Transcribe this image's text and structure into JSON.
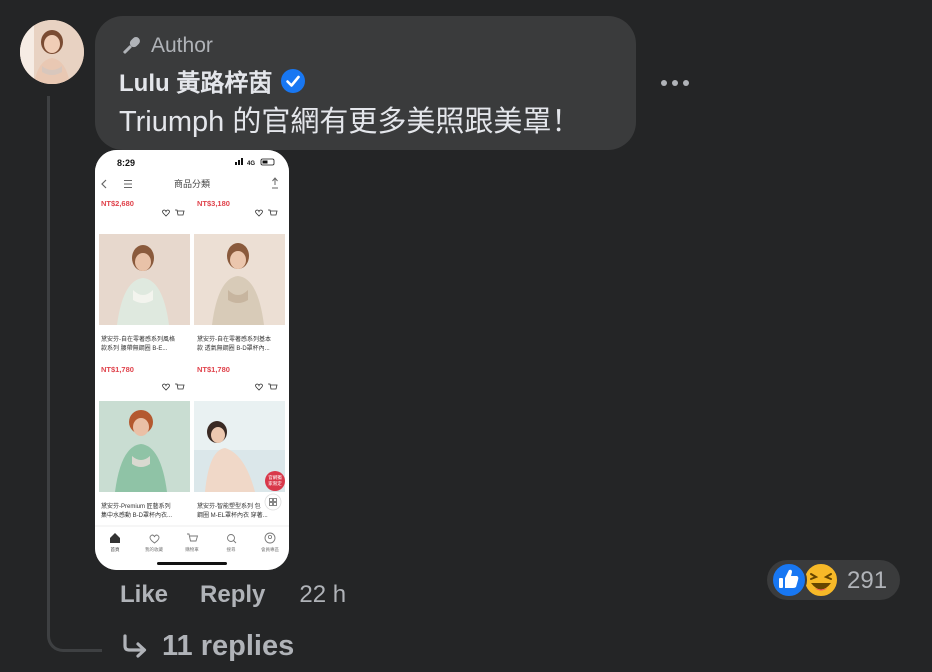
{
  "comment": {
    "badge_label": "Author",
    "author_name": "Lulu 黃路梓茵",
    "verified": true,
    "text": "Triumph 的官網有更多美照跟美罩！"
  },
  "attachment": {
    "status_time": "8:29",
    "signal_label": "4G",
    "page_title": "商品分類",
    "products": [
      {
        "price": "NT$2,680",
        "title_line1": "黛安芬-自在零著感系列風格",
        "title_line2": "款系列 腰帶無鋼圈 B-E..."
      },
      {
        "price": "NT$3,180",
        "title_line1": "黛安芬-自在零著感系列基本",
        "title_line2": "款 透氣無鋼圈 B-D罩杯內..."
      },
      {
        "price": "NT$1,780",
        "title_line1": "黛安芬-Premium 匠藝系列",
        "title_line2": "集中水感動 B-D罩杯內衣..."
      },
      {
        "price": "NT$1,780",
        "title_line1": "黛安芬-智能塑型系列 包",
        "title_line2": "鋼圈 M-EL罩杯內衣 穿著..."
      }
    ],
    "promo_tag_line1": "官網獨",
    "promo_tag_line2": "家限定",
    "nav": [
      "首頁",
      "我的收藏",
      "購物車",
      "搜尋",
      "會員專區"
    ]
  },
  "actions": {
    "like_label": "Like",
    "reply_label": "Reply",
    "timestamp": "22 h"
  },
  "reactions": {
    "types": [
      "like",
      "haha"
    ],
    "count": "291"
  },
  "replies": {
    "label": "11 replies"
  },
  "colors": {
    "background": "#242526",
    "bubble": "#3a3b3c",
    "text": "#e4e6eb",
    "secondary": "#b0b3b8",
    "verified": "#1877f2",
    "like": "#1877f2",
    "haha": "#f7b928",
    "price": "#e0434c"
  }
}
